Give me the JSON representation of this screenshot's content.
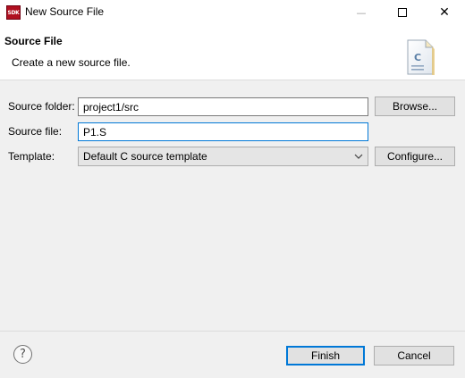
{
  "window": {
    "icon_text": "SDK",
    "title": "New Source File",
    "minimize_icon": "minimize-icon",
    "maximize_icon": "maximize-icon",
    "close_icon": "close-icon",
    "close_glyph": "✕",
    "minimize_glyph": "—"
  },
  "header": {
    "title": "Source File",
    "description": "Create a new source file.",
    "image_letter": "C"
  },
  "form": {
    "source_folder_label": "Source folder:",
    "source_folder_value": "project1/src",
    "browse_label": "Browse...",
    "source_file_label": "Source file:",
    "source_file_value": "P1.S",
    "template_label": "Template:",
    "template_value": "Default C source template",
    "configure_label": "Configure..."
  },
  "footer": {
    "help_glyph": "?",
    "finish_label": "Finish",
    "cancel_label": "Cancel"
  },
  "colors": {
    "accent": "#0078d7",
    "app_icon": "#b01020"
  }
}
